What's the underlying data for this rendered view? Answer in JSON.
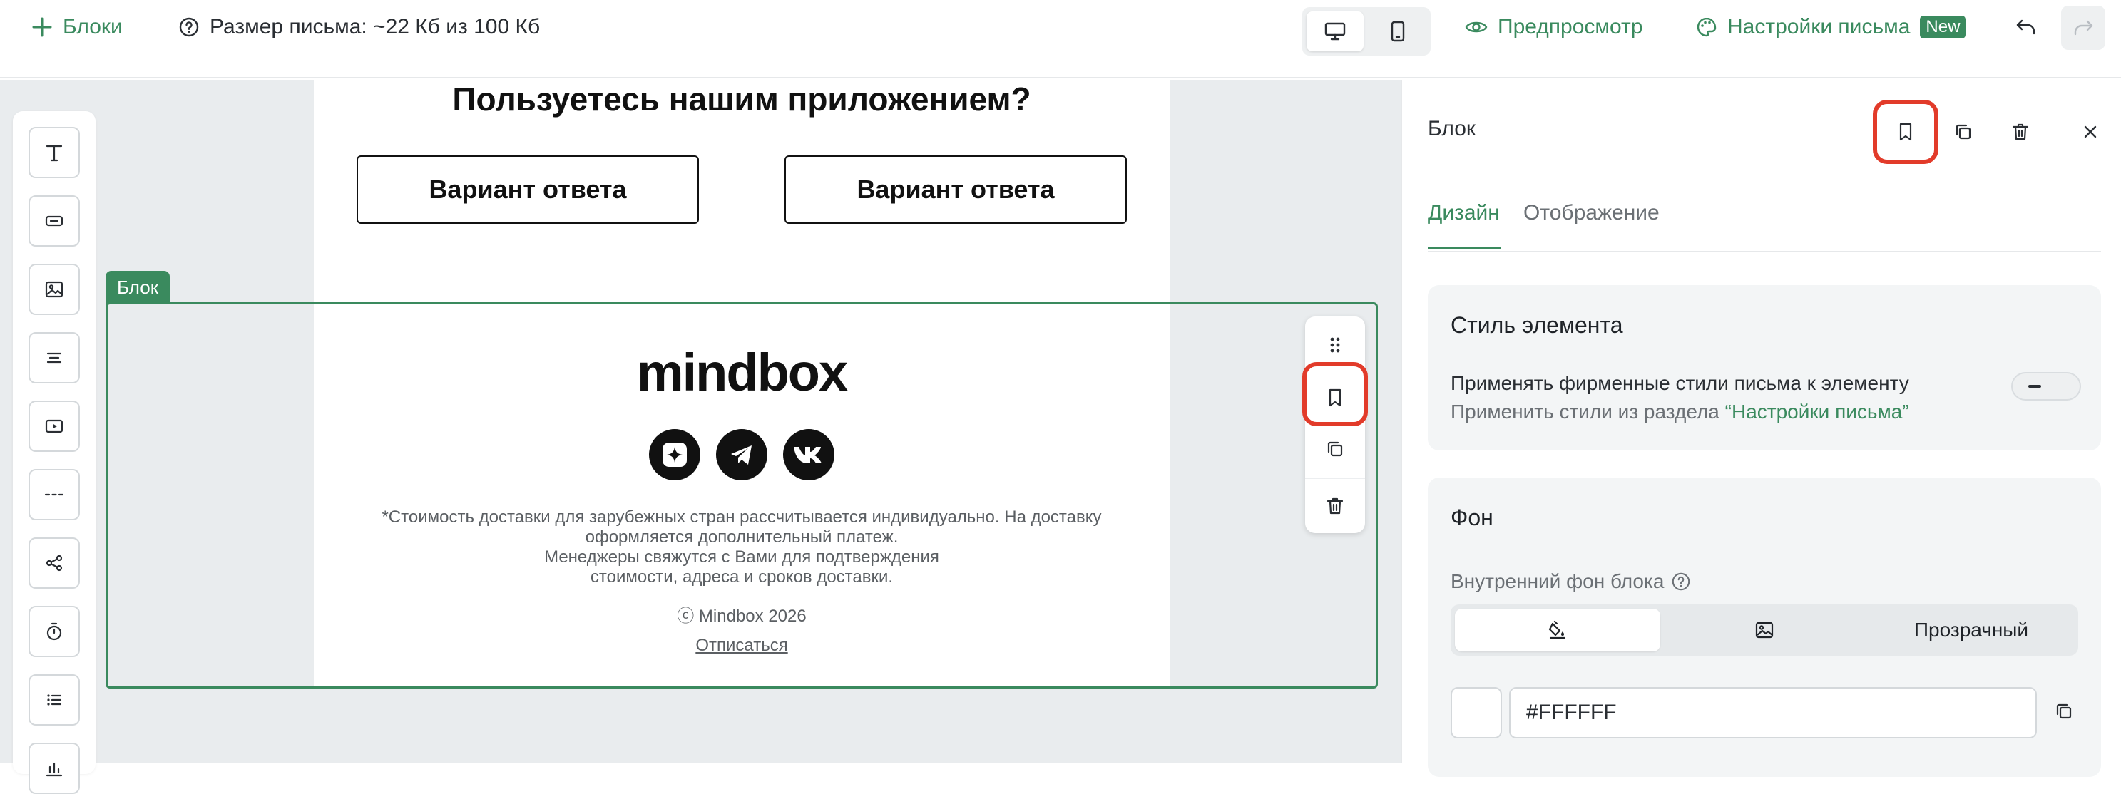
{
  "topbar": {
    "blocks_label": "Блоки",
    "size_label": "Размер письма: ~22 Кб из 100 Кб",
    "preview_label": "Предпросмотр",
    "settings_label": "Настройки письма",
    "settings_badge": "New"
  },
  "email": {
    "poll_title": "Пользуетесь нашим приложением?",
    "answers": [
      "Вариант ответа",
      "Вариант ответа"
    ],
    "selected_block_label": "Блок",
    "logo_text": "mindbox",
    "disclaimer_lines": [
      "*Стоимость доставки для зарубежных стран рассчитывается индивидуально. На доставку",
      "оформляется дополнительный платеж.",
      "Менеджеры свяжутся с Вами для подтверждения",
      "стоимости, адреса и сроков доставки."
    ],
    "copyright": "ⓒ Mindbox 2026",
    "unsubscribe": "Отписаться"
  },
  "panel": {
    "title": "Блок",
    "tabs": [
      {
        "label": "Дизайн",
        "active": true
      },
      {
        "label": "Отображение",
        "active": false
      }
    ],
    "style_card": {
      "title": "Стиль элемента",
      "toggle_label": "Применять фирменные стили письма к элементу",
      "toggle_sub_prefix": "Применить стили из раздела ",
      "toggle_sub_link": "“Настройки письма”"
    },
    "bg_card": {
      "title": "Фон",
      "label": "Внутренний фон блока",
      "transparent_label": "Прозрачный",
      "color_value": "#FFFFFF"
    }
  },
  "colors": {
    "accent": "#3a8a5e",
    "highlight": "#e23b2a"
  }
}
